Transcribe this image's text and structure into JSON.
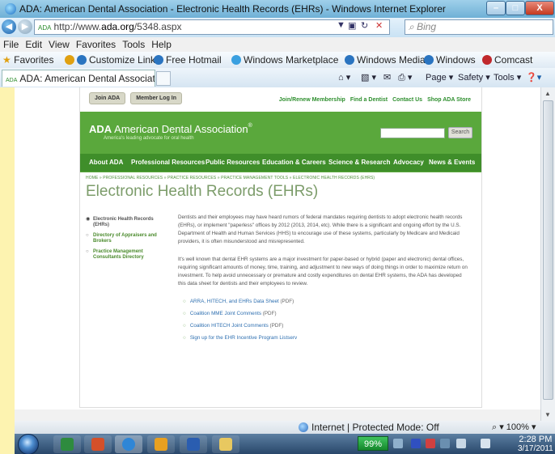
{
  "window": {
    "title": "ADA: American Dental Association - Electronic Health Records (EHRs) - Windows Internet Explorer",
    "controls": {
      "minimize": "–",
      "maximize": "□",
      "close": "X"
    }
  },
  "address": {
    "favicon": "ADA",
    "url_prefix": "http://www.",
    "url_domain": "ada.org",
    "url_path": "/5348.aspx",
    "search_placeholder": "Bing"
  },
  "menu": [
    "File",
    "Edit",
    "View",
    "Favorites",
    "Tools",
    "Help"
  ],
  "favorites_bar": {
    "favorites_label": "Favorites",
    "items": [
      "Customize Links",
      "Free Hotmail",
      "Windows Marketplace",
      "Windows Media",
      "Windows",
      "Comcast"
    ]
  },
  "tab": {
    "favicon": "ADA",
    "title": "ADA: American Dental Associat..."
  },
  "command_bar": {
    "page": "Page",
    "safety": "Safety",
    "tools": "Tools"
  },
  "site": {
    "top_buttons": [
      "Join ADA",
      "Member Log In"
    ],
    "top_links": [
      "Join/Renew Membership",
      "Find a Dentist",
      "Contact Us",
      "Shop ADA Store"
    ],
    "logo_abbr": "ADA",
    "logo_name": "American Dental Association",
    "logo_reg": "®",
    "tagline": "America's leading advocate for oral health",
    "search_button": "Search",
    "nav": [
      "About ADA",
      "Professional Resources",
      "Public Resources",
      "Education & Careers",
      "Science & Research",
      "Advocacy",
      "News & Events"
    ],
    "breadcrumb": "HOME » PROFESSIONAL RESOURCES » PRACTICE RESOURCES » PRACTICE MANAGEMENT TOOLS » ELECTRONIC HEALTH RECORDS (EHRS)",
    "page_title": "Electronic Health Records (EHRs)",
    "sidebar": [
      {
        "label": "Electronic Health Records (EHRs)",
        "active": true
      },
      {
        "label": "Directory of Appraisers and Brokers",
        "active": false
      },
      {
        "label": "Practice Management Consultants Directory",
        "active": false
      }
    ],
    "paragraphs": [
      "Dentists and their employees may have heard rumors of federal mandates requiring dentists to adopt electronic health records (EHRs), or implement \"paperless\" offices by 2012 (2013, 2014, etc). While there is a significant and ongoing effort by the U.S. Department of Health and Human Services (HHS) to encourage use of these systems, particularly by Medicare and Medicaid providers, it is often misunderstood and misrepresented.",
      "It's well known that dental EHR systems are a major investment for paper-based or hybrid (paper and electronic) dental offices, requiring significant amounts of money, time, training, and adjustment to new ways of doing things in order to maximize return on investment. To help avoid unnecessary or premature and costly expenditures on dental EHR systems, the ADA has developed this data sheet for dentists and their employees to review."
    ],
    "links": [
      {
        "text": "ARRA, HITECH, and EHRs Data Sheet",
        "note": " (PDF)"
      },
      {
        "text": "Coalition MME Joint Comments",
        "note": " (PDF)"
      },
      {
        "text": "Coalition HITECH Joint Comments",
        "note": " (PDF)"
      },
      {
        "text": "Sign up for the EHR Incentive Program Listserv",
        "note": ""
      }
    ]
  },
  "status": {
    "zone": "Internet | Protected Mode: Off",
    "zoom": "100%"
  },
  "taskbar": {
    "battery": "99%",
    "time": "2:28 PM",
    "date": "3/17/2011"
  },
  "colors": {
    "ada_green": "#55a53a",
    "nav_green": "#3f8e2a",
    "title_green": "#7c9c6a",
    "link_blue": "#2e6fb0"
  }
}
